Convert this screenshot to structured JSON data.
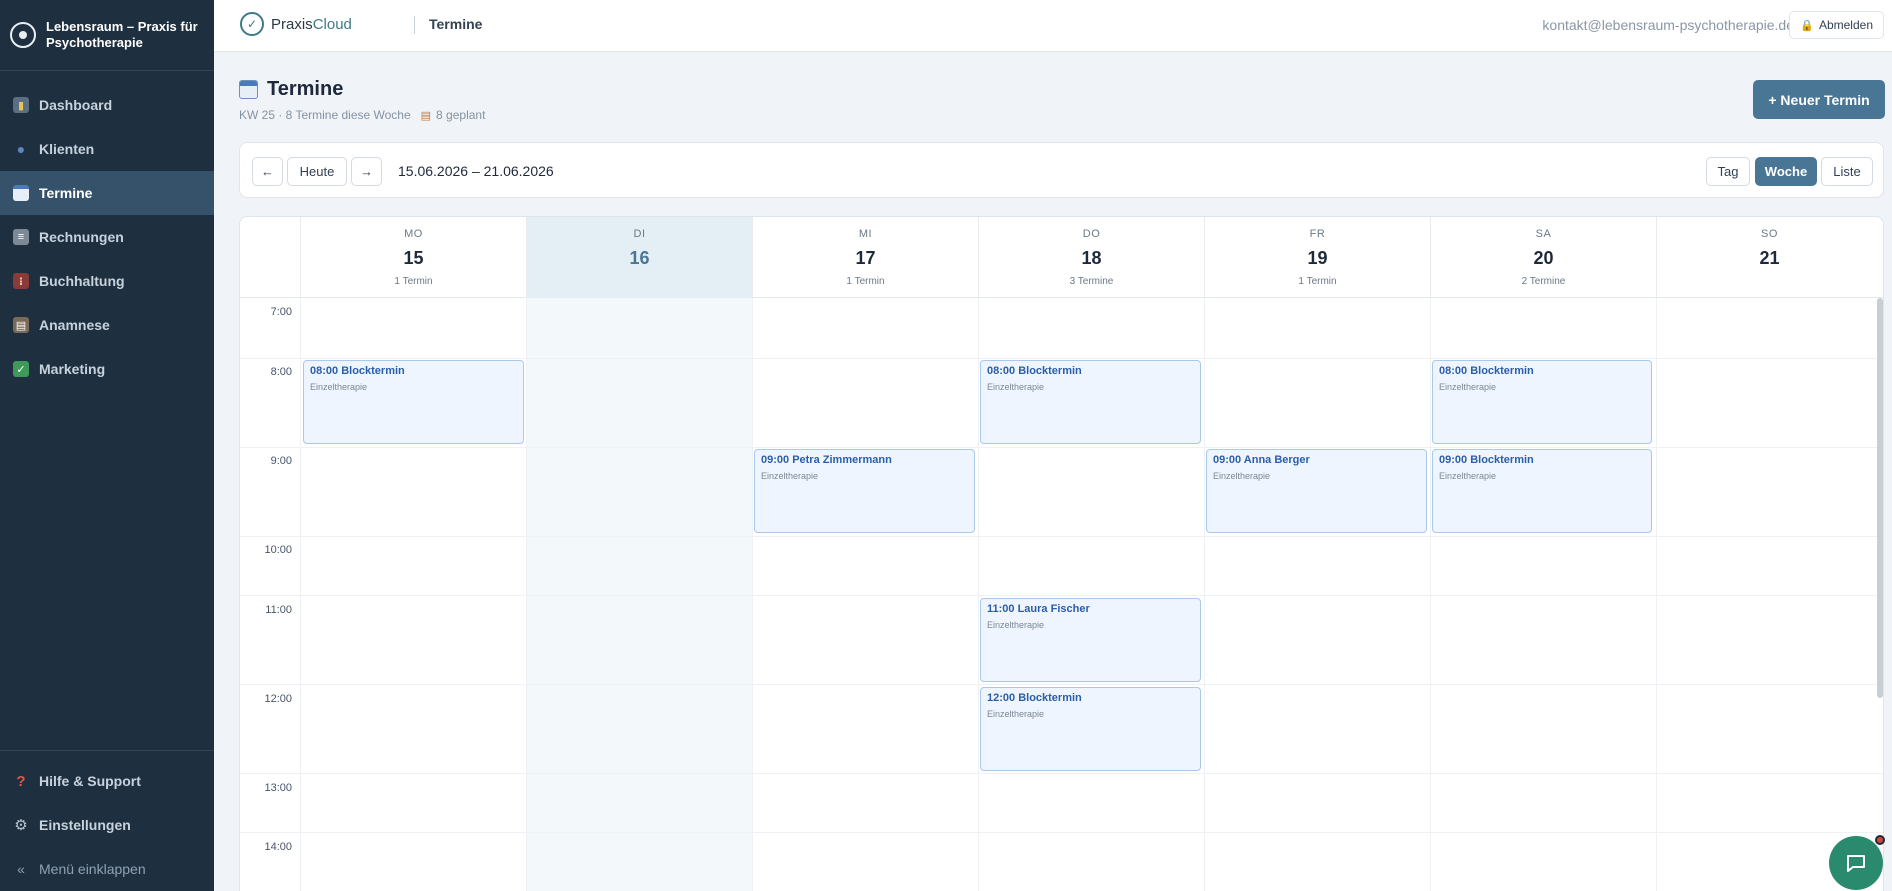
{
  "sidebar": {
    "brand": "Lebensraum – Praxis für Psychotherapie",
    "items": [
      {
        "label": "Dashboard",
        "icon": "bar-chart-icon"
      },
      {
        "label": "Klienten",
        "icon": "user-icon"
      },
      {
        "label": "Termine",
        "icon": "calendar-icon"
      },
      {
        "label": "Rechnungen",
        "icon": "ledger-icon"
      },
      {
        "label": "Buchhaltung",
        "icon": "abacus-icon"
      },
      {
        "label": "Anamnese",
        "icon": "notebook-icon"
      },
      {
        "label": "Marketing",
        "icon": "checkbox-icon"
      }
    ],
    "bottom": [
      {
        "label": "Hilfe & Support",
        "icon": "question-icon"
      },
      {
        "label": "Einstellungen",
        "icon": "gear-icon"
      },
      {
        "label": "Menü einklappen",
        "icon": "double-chevron-left-icon"
      }
    ]
  },
  "topbar": {
    "logo_a": "Praxis",
    "logo_b": "Cloud",
    "title": "Termine",
    "email": "kontakt@lebensraum-psychotherapie.de",
    "logout": "Abmelden"
  },
  "page": {
    "title": "Termine",
    "subtitle": "KW 25 · 8 Termine diese Woche",
    "planned": "8 geplant",
    "new_button": "+ Neuer Termin"
  },
  "toolbar": {
    "prev": "←",
    "today": "Heute",
    "next": "→",
    "range": "15.06.2026 – 21.06.2026",
    "views": [
      "Tag",
      "Woche",
      "Liste"
    ],
    "active_view": "Woche"
  },
  "calendar": {
    "days": [
      {
        "dow": "MO",
        "num": "15",
        "count": "1 Termin"
      },
      {
        "dow": "DI",
        "num": "16",
        "count": ""
      },
      {
        "dow": "MI",
        "num": "17",
        "count": "1 Termin"
      },
      {
        "dow": "DO",
        "num": "18",
        "count": "3 Termine"
      },
      {
        "dow": "FR",
        "num": "19",
        "count": "1 Termin"
      },
      {
        "dow": "SA",
        "num": "20",
        "count": "2 Termine"
      },
      {
        "dow": "SO",
        "num": "21",
        "count": ""
      }
    ],
    "today": "16",
    "hours": [
      "7:00",
      "8:00",
      "9:00",
      "10:00",
      "11:00",
      "12:00",
      "13:00",
      "14:00"
    ],
    "events": [
      {
        "title": "08:00 Blocktermin",
        "type": "Einzeltherapie"
      },
      {
        "title": "08:00 Blocktermin",
        "type": "Einzeltherapie"
      },
      {
        "title": "08:00 Blocktermin",
        "type": "Einzeltherapie"
      },
      {
        "title": "09:00 Petra Zimmermann",
        "type": "Einzeltherapie"
      },
      {
        "title": "09:00 Anna Berger",
        "type": "Einzeltherapie"
      },
      {
        "title": "09:00 Blocktermin",
        "type": "Einzeltherapie"
      },
      {
        "title": "11:00 Laura Fischer",
        "type": "Einzeltherapie"
      },
      {
        "title": "12:00 Blocktermin",
        "type": "Einzeltherapie"
      }
    ]
  },
  "colors": {
    "sidebar_bg": "#1e3040",
    "accent": "#4a7696",
    "event_text": "#2b5ea8",
    "chat": "#2a8a6e"
  }
}
